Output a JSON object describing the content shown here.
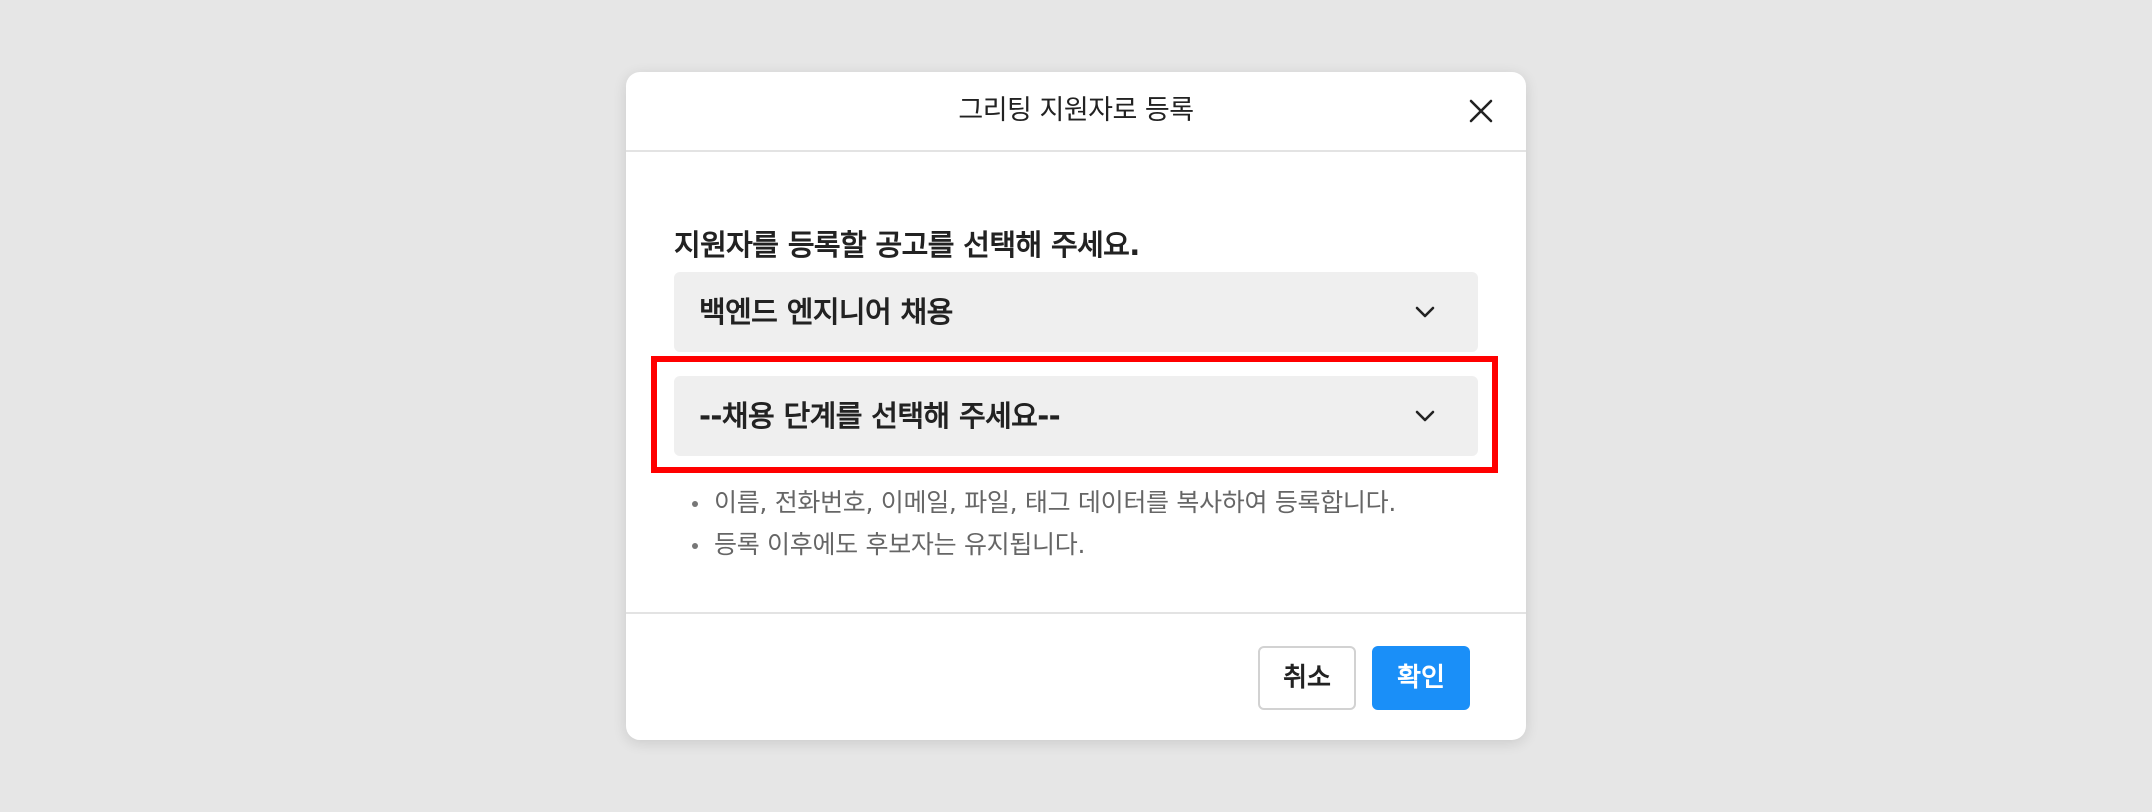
{
  "modal": {
    "title": "그리팅 지원자로 등록",
    "close_icon": "close-icon",
    "prompt": "지원자를 등록할 공고를 선택해 주세요.",
    "job_select": {
      "selected": "백엔드 엔지니어 채용",
      "icon": "chevron-down-icon"
    },
    "stage_select": {
      "selected": "--채용 단계를 선택해 주세요--",
      "icon": "chevron-down-icon"
    },
    "notes": [
      "이름, 전화번호, 이메일, 파일, 태그 데이터를 복사하여 등록합니다.",
      "등록 이후에도 후보자는 유지됩니다."
    ],
    "buttons": {
      "cancel": "취소",
      "confirm": "확인"
    }
  },
  "colors": {
    "background": "#e6e6e6",
    "select_background": "#efefef",
    "primary": "#1a8ff8",
    "highlight": "#ff0000"
  }
}
